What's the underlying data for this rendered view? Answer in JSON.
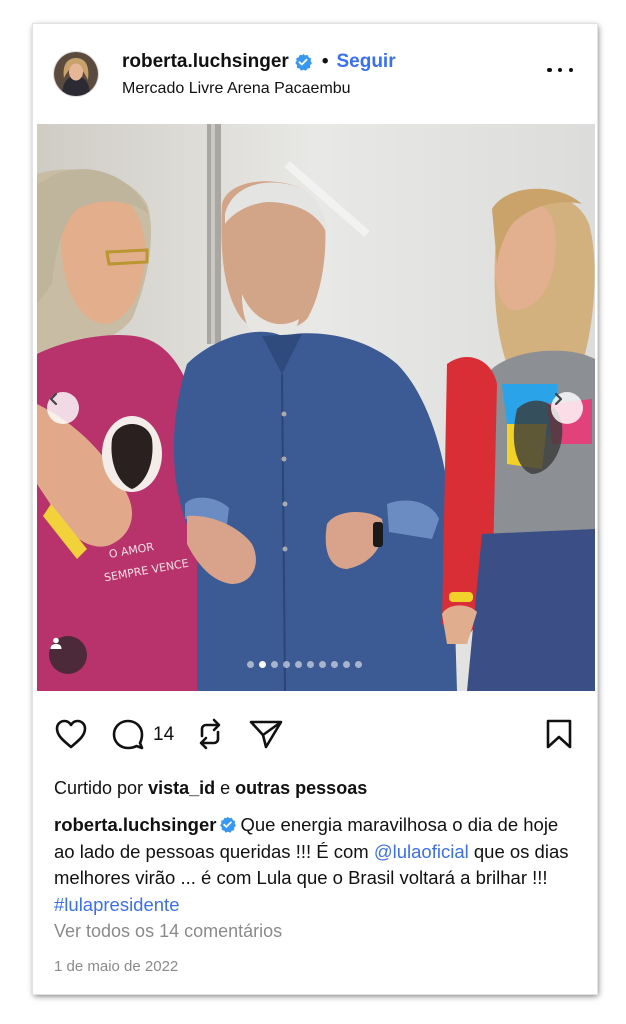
{
  "post": {
    "username": "roberta.luchsinger",
    "separator": "•",
    "follow_label": "Seguir",
    "location": "Mercado Livre Arena Pacaembu",
    "comment_count": "14",
    "liked_by": {
      "prefix": "Curtido por",
      "user": "vista_id",
      "conj": "e",
      "others": "outras pessoas"
    },
    "caption": {
      "username": "roberta.luchsinger",
      "text_1": "Que energia maravilhosa o dia de hoje ao lado de pessoas queridas !!! É com",
      "mention": "@lulaoficial",
      "text_2": "que os dias melhores virão ... é com Lula que o Brasil voltará a brilhar !!!",
      "hashtag": "#lulapresidente"
    },
    "view_comments": "Ver todos os 14 comentários",
    "date": "1 de maio de 2022",
    "shirt_text": "O AMOR SEMPRE VENCE",
    "carousel": {
      "count": 10,
      "active_index": 1
    }
  },
  "colors": {
    "accent": "#3b6ff0",
    "verified": "#3897f0",
    "text": "#111111",
    "muted": "#8a8a8a"
  },
  "icons": [
    "avatar",
    "verified-badge-icon",
    "more-options-icon",
    "chevron-left-icon",
    "chevron-right-icon",
    "user-tag-icon",
    "heart-icon",
    "comment-icon",
    "repost-icon",
    "share-icon",
    "bookmark-icon"
  ]
}
